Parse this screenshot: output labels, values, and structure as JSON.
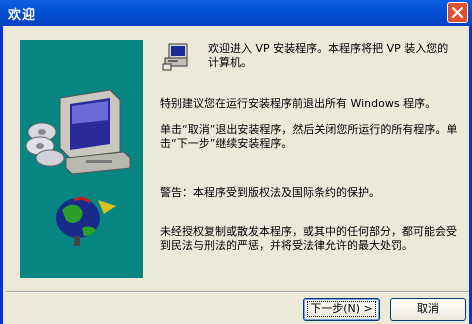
{
  "window": {
    "title": "欢迎",
    "close_icon": "close-icon"
  },
  "content": {
    "intro": "欢迎进入 VP 安装程序。本程序将把 VP 装入您的计算机。",
    "para_close": "特别建议您在运行安装程序前退出所有 Windows 程序。",
    "para_cancel": "单击“取消”退出安装程序，然后关闭您所运行的所有程序。单击“下一步”继续安装程序。",
    "para_warning": "警告：本程序受到版权法及国际条约的保护。",
    "para_legal": "未经授权复制或散发本程序，或其中的任何部分，都可能会受到民法与刑法的严惩，并将受法律允许的最大处罚。"
  },
  "buttons": {
    "next": "下一步(N) >",
    "cancel": "取消"
  },
  "colors": {
    "titlebar": "#0450d5",
    "art_bg": "#078582",
    "dialog_bg": "#ece9d8"
  }
}
